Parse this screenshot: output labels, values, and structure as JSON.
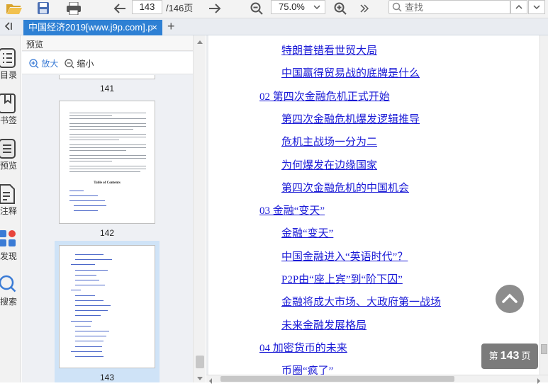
{
  "toolbar": {
    "current_page": "143",
    "total_pages": "/146页",
    "zoom": "75.0%",
    "search_placeholder": "查找"
  },
  "tab": {
    "title": "中国经济2019[www.j9p.com].p",
    "close_glyph": "×",
    "add_glyph": "+"
  },
  "rail": {
    "items": [
      {
        "label": "目录",
        "icon": "list-icon"
      },
      {
        "label": "书签",
        "icon": "bookmark-icon"
      },
      {
        "label": "预览",
        "icon": "preview-icon"
      },
      {
        "label": "注释",
        "icon": "annotation-icon"
      },
      {
        "label": "发现",
        "icon": "discover-icon"
      },
      {
        "label": "搜索",
        "icon": "search-icon"
      }
    ]
  },
  "preview": {
    "title": "预览",
    "close_glyph": "×",
    "zoom_in": "放大",
    "zoom_out": "缩小",
    "thumbnails": [
      {
        "label": "141"
      },
      {
        "label": "142",
        "heading": "Table of Contents"
      },
      {
        "label": "143"
      }
    ]
  },
  "toc": [
    {
      "text": "特朗普错看世贸大局",
      "level": 2
    },
    {
      "text": "中国赢得贸易战的底牌是什么",
      "level": 2
    },
    {
      "text": "02 第四次金融危机正式开始",
      "level": 1
    },
    {
      "text": "第四次金融危机爆发逻辑推导",
      "level": 2
    },
    {
      "text": "危机主战场一分为二",
      "level": 2
    },
    {
      "text": "为何爆发在边缘国家",
      "level": 2
    },
    {
      "text": "第四次金融危机的中国机会",
      "level": 2
    },
    {
      "text": "03 金融“变天”",
      "level": 1
    },
    {
      "text": "金融“变天”",
      "level": 2
    },
    {
      "text": "中国金融进入“英语时代”？",
      "level": 2
    },
    {
      "text": "P2P由“座上宾”到“阶下囚”",
      "level": 2
    },
    {
      "text": "金融将成大市场、大政府第一战场",
      "level": 2
    },
    {
      "text": "未来金融发展格局",
      "level": 2
    },
    {
      "text": "04 加密货币的未来",
      "level": 1
    },
    {
      "text": "币圈“疯了”",
      "level": 2
    }
  ],
  "page_badge": {
    "prefix": "第",
    "number": "143",
    "suffix": "页"
  }
}
